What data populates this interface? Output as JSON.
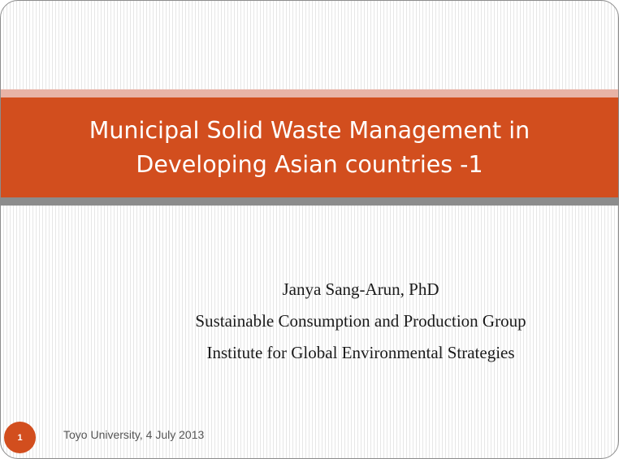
{
  "slide": {
    "title_line1": "Municipal Solid Waste Management in",
    "title_line2": "Developing Asian countries -1",
    "author": "Janya Sang-Arun, PhD",
    "group": "Sustainable Consumption and Production Group",
    "institute": "Institute for Global Environmental Strategies",
    "slide_number": "1",
    "footer": "Toyo University, 4 July 2013"
  },
  "colors": {
    "accent": "#d24e1e",
    "accent_light": "#e8b3a6",
    "divider_gray": "#8c8c8c"
  }
}
